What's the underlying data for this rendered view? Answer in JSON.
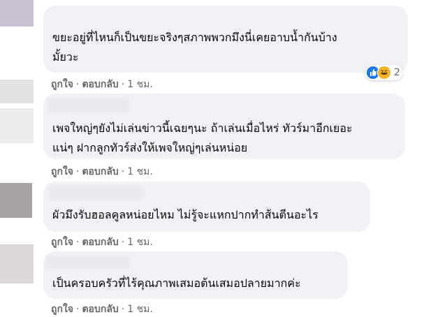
{
  "comments": [
    {
      "lines": [
        "ขยะอยู่ที่ไหนก็เป็นขยะจริงๆสภาพพวกมึงนี่เคยอาบน้ำกันบ้าง",
        "มั้ยวะ"
      ],
      "like_label": "ถูกใจ",
      "reply_label": "ตอบกลับ",
      "time": "1 ชม.",
      "reaction": {
        "icons": [
          "like-icon",
          "haha-icon"
        ],
        "count": "2"
      }
    },
    {
      "lines": [
        "เพจใหญ่ๆยังไม่เล่นข่าวนี้เฉยๆนะ ถ้าเล่นเมื่อไหร่ ทัวร์มาอีกเยอะ",
        "แน่ๆ ฝากลูกทัวร์ส่งให้เพจใหญ่ๆเล่นหน่อย"
      ],
      "like_label": "ถูกใจ",
      "reply_label": "ตอบกลับ",
      "time": "1 ชม."
    },
    {
      "lines": [
        "ผัวมึงรับฮอลคูลหน่อยไหม ไม่รู้จะแหกปากทำส้นตีนอะไร"
      ],
      "like_label": "ถูกใจ",
      "reply_label": "ตอบกลับ",
      "time": "1 ชม."
    },
    {
      "lines": [
        "เป็นครอบครัวที่ไร้คุณภาพเสมอต้นเสมอปลายมากค่ะ"
      ],
      "like_label": "ถูกใจ",
      "reply_label": "ตอบกลับ",
      "time": "1 ชม."
    }
  ],
  "separator": "·",
  "colors": {
    "bubble": "#f0f2f5",
    "meta": "#65676b",
    "like_reaction": "#1877f2",
    "haha_reaction": "#f7b125"
  }
}
